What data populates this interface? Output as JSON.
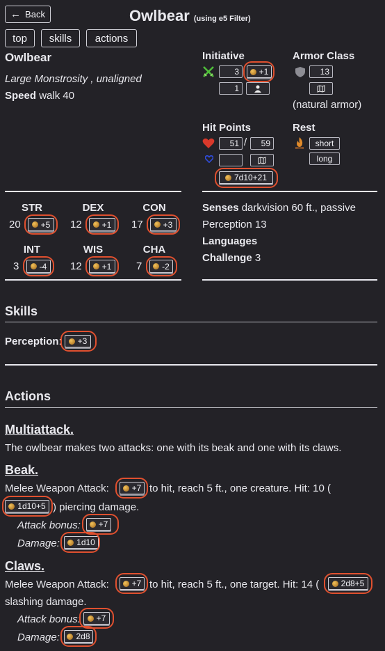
{
  "nav": {
    "back_label": "Back",
    "tabs": [
      "top",
      "skills",
      "actions"
    ]
  },
  "header": {
    "title": "Owlbear",
    "subtitle": "(using e5 Filter)"
  },
  "creature": {
    "name": "Owlbear",
    "type_line": "Large Monstrosity , unaligned",
    "speed_label": "Speed",
    "speed_value": "walk 40"
  },
  "initiative": {
    "label": "Initiative",
    "value": "3",
    "roll": "+1",
    "count": "1"
  },
  "armor_class": {
    "label": "Armor Class",
    "value": "13",
    "note": "(natural armor)"
  },
  "hit_points": {
    "label": "Hit Points",
    "current": "51",
    "slash": "/",
    "max": "59",
    "temp": "",
    "roll": "7d10+21"
  },
  "rest": {
    "label": "Rest",
    "short": "short",
    "long": "long"
  },
  "abilities": [
    {
      "name": "STR",
      "score": "20",
      "mod": "+5"
    },
    {
      "name": "DEX",
      "score": "12",
      "mod": "+1"
    },
    {
      "name": "CON",
      "score": "17",
      "mod": "+3"
    },
    {
      "name": "INT",
      "score": "3",
      "mod": "-4"
    },
    {
      "name": "WIS",
      "score": "12",
      "mod": "+1"
    },
    {
      "name": "CHA",
      "score": "7",
      "mod": "-2"
    }
  ],
  "senses": {
    "senses_label": "Senses",
    "senses_value_1": "darkvision 60 ft., passive",
    "senses_value_2": "Perception 13",
    "languages_label": "Languages",
    "challenge_label": "Challenge",
    "challenge_value": "3"
  },
  "skills": {
    "title": "Skills",
    "perception_label": "Perception",
    "colon": ":",
    "perception_roll": "+3"
  },
  "actions": {
    "title": "Actions",
    "multiattack": {
      "name": "Multiattack.",
      "text": "The owlbear makes two attacks: one with its beak and one with its claws."
    },
    "beak": {
      "name": "Beak.",
      "line1_a": "Melee Weapon Attack:",
      "roll_hit": "+7",
      "line1_b": "to hit, reach 5 ft., one creature. Hit: 10 (",
      "damage_roll": "1d10+5",
      "line2_b": ") piercing damage.",
      "attack_bonus_label": "Attack bonus:",
      "attack_bonus_roll": "+7",
      "damage_label": "Damage:",
      "damage_short_roll": "1d10"
    },
    "claws": {
      "name": "Claws.",
      "line1_a": "Melee Weapon Attack:",
      "roll_hit": "+7",
      "line1_b": "to hit, reach 5 ft., one target. Hit: 14 (",
      "damage_roll": "2d8+5",
      "line2": "slashing damage.",
      "attack_bonus_label": "Attack bonus:",
      "attack_bonus_roll": "+7",
      "damage_label": "Damage:",
      "damage_short_roll": "2d8"
    }
  },
  "colors": {
    "background": "#232227",
    "highlight_ring": "#e0502f",
    "heart": "#d9392b",
    "temp_heart": "#2f4bd8",
    "init_icon": "#4fbe3a",
    "fire": "#e08a2a"
  },
  "icons": {
    "back": "arrow-left-icon",
    "initiative": "crossed-swords-icon",
    "ac": "shield-icon",
    "hp": "heart-icon",
    "temp_hp": "blue-heart-icon",
    "rest": "campfire-icon",
    "map": "map-icon",
    "person": "person-icon",
    "die": "d20-icon"
  }
}
